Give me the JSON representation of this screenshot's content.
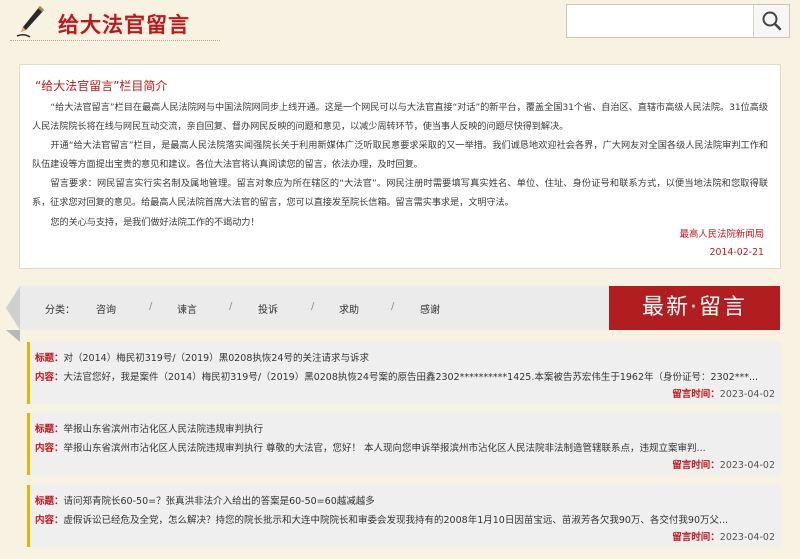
{
  "header": {
    "title": "给大法官留言",
    "search_placeholder": "",
    "search_icon": "search-icon"
  },
  "intro": {
    "heading": "“给大法官留言”栏目简介",
    "paragraphs": [
      "“给大法官留言”栏目在最高人民法院网与中国法院网同步上线开通。这是一个网民可以与大法官直接“对话”的新平台，覆盖全国31个省、自治区、直辖市高级人民法院。31位高级人民法院院长将在线与网民互动交流，亲自回复、督办网民反映的问题和意见，以减少周转环节，使当事人反映的问题尽快得到解决。",
      "开通“给大法官留言”栏目，是最高人民法院落实闻强院长关于利用新媒体广泛听取民意要求采取的又一举措。我们诚恳地欢迎社会各界，广大网友对全国各级人民法院审判工作和队伍建设等方面提出宝贵的意见和建议。各位大法官将认真阅读您的留言，依法办理，及时回复。",
      "留言要求：网民留言实行实名制及属地管理。留言对象应为所在辖区的“大法官”。网民注册时需要填写真实姓名、单位、住址、身份证号和联系方式，以便当地法院和您取得联系，征求您对回复的意见。给最高人民法院首席大法官的留言，您可以直接发至院长信箱。留言需实事求是，文明守法。",
      "您的关心与支持，是我们做好法院工作的不竭动力！"
    ],
    "signature_org": "最高人民法院新闻局",
    "signature_date": "2014-02-21"
  },
  "categories": {
    "prefix": "分类：",
    "items": [
      "咨询",
      "谏言",
      "投诉",
      "求助",
      "感谢"
    ],
    "separator": "/"
  },
  "latest_banner": "最新·留言",
  "labels": {
    "title": "标题：",
    "content": "内容：",
    "time": "留言时间："
  },
  "messages": [
    {
      "title": "对（2014）梅民初319号/（2019）黑0208执恢24号的关注请求与诉求",
      "content": "大法官您好，我是案件（2014）梅民初319号/（2019）黑0208执恢24号案的原告田鑫2302**********1425.本案被告苏宏伟生于1962年（身份证号：2302***...",
      "time": "2023-04-02"
    },
    {
      "title": "举报山东省滨州市沾化区人民法院违规审判执行",
      "content": "举报山东省滨州市沾化区人民法院违规审判执行 尊敬的大法官，您好！ 本人现向您申诉举报滨州市沾化区人民法院非法制造管辖联系点，违规立案审判...",
      "time": "2023-04-02"
    },
    {
      "title": "请问郑青院长60-50=？张真洪非法介入给出的答案是60-50=60越减越多",
      "content": "虚假诉讼已经危及全党，怎么解决？持您的院长批示和大连中院院长和审委会发现我持有的2008年1月10日因苗宝远、苗淑芳各欠我90万、各交付我90万父...",
      "time": "2023-04-02"
    }
  ],
  "colors": {
    "accent_red": "#c0171c",
    "banner_red": "#b21d20",
    "page_bg": "#f7f2e1",
    "message_bar": "#e0b800"
  }
}
